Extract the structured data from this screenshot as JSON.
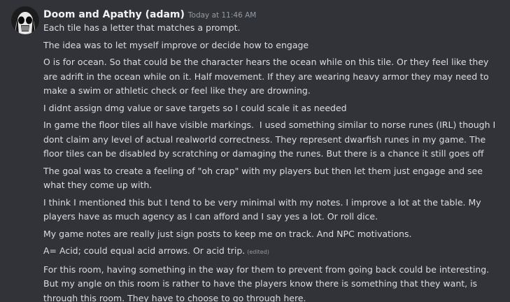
{
  "message": {
    "author": "Doom and Apathy (adam)",
    "timestamp": "Today at 11:46 AM",
    "lines": [
      "Each tile has a letter that matches a prompt.",
      "The idea was to let myself improve or decide how to engage",
      "O is for ocean. So that could be the character hears the ocean while on this tile. Or they feel like they are adrift in the ocean while on it. Half movement. If they are wearing heavy armor they may need to make a swim or athletic check or feel like they are drowning.",
      "I didnt assign dmg value or save targets so I could scale it as needed",
      "In game the floor tiles all have visible markings.  I used something similar to norse runes (IRL) though I dont claim any level of actual realworld correctness. They represent dwarfish runes in my game. The floor tiles can be disabled by scratching or damaging the runes. But there is a chance it still goes off",
      "The goal was to create a feeling of \"oh crap\" with my players but then let them just engage and see what they come up with.",
      "I think I mentioned this but I tend to be very minimal with my notes. I improve a lot at the table. My players have as much agency as I can afford and I say yes a lot. Or roll dice.",
      "My game notes are really just sign posts to keep me on track. And NPC motivations.",
      "A= Acid; could equal acid arrows. Or acid trip.",
      "For this room, having something in the way for them to prevent from going back could be interesting. But my angle on this room is rather to have the players know there is something that they want, is through this room. They have to choose to go through here."
    ],
    "edited_label": "(edited)"
  }
}
